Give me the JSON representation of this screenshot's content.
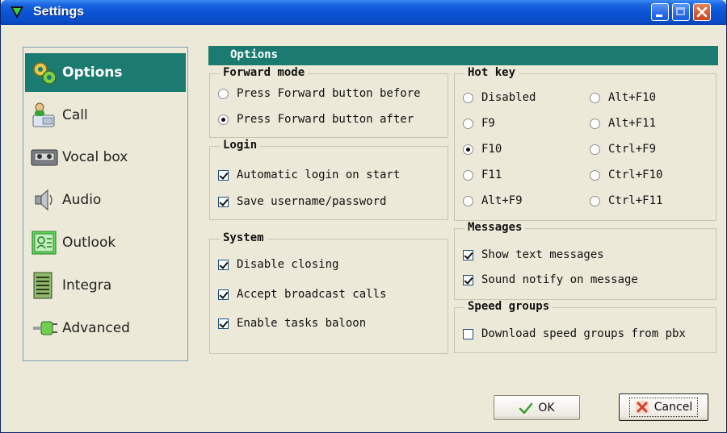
{
  "window": {
    "title": "Settings"
  },
  "sidebar": {
    "items": [
      {
        "label": "Options",
        "icon": "gears-icon",
        "selected": true
      },
      {
        "label": "Call",
        "icon": "phone-icon"
      },
      {
        "label": "Vocal box",
        "icon": "voicemail-tape-icon"
      },
      {
        "label": "Audio",
        "icon": "speaker-icon"
      },
      {
        "label": "Outlook",
        "icon": "outlook-contact-icon"
      },
      {
        "label": "Integra",
        "icon": "integra-rack-icon"
      },
      {
        "label": "Advanced",
        "icon": "plug-icon"
      }
    ]
  },
  "panel": {
    "title": "Options"
  },
  "forward_mode": {
    "title": "Forward mode",
    "options": [
      "Press Forward button before",
      "Press Forward button after"
    ],
    "selected": "Press Forward button after"
  },
  "login": {
    "title": "Login",
    "options": [
      {
        "label": "Automatic login on start",
        "checked": true
      },
      {
        "label": "Save username/password",
        "checked": true
      }
    ]
  },
  "system": {
    "title": "System",
    "options": [
      {
        "label": "Disable closing",
        "checked": true
      },
      {
        "label": "Accept broadcast calls",
        "checked": true
      },
      {
        "label": "Enable tasks baloon",
        "checked": true
      }
    ]
  },
  "hot_key": {
    "title": "Hot key",
    "options": [
      "Disabled",
      "F9",
      "F10",
      "F11",
      "Alt+F9",
      "Alt+F10",
      "Alt+F11",
      "Ctrl+F9",
      "Ctrl+F10",
      "Ctrl+F11"
    ],
    "selected": "F10"
  },
  "messages": {
    "title": "Messages",
    "options": [
      {
        "label": "Show text messages",
        "checked": true
      },
      {
        "label": "Sound notify on message",
        "checked": true
      }
    ]
  },
  "speed_groups": {
    "title": "Speed groups",
    "options": [
      {
        "label": "Download speed groups from pbx",
        "checked": false
      }
    ]
  },
  "buttons": {
    "ok": "OK",
    "cancel": "Cancel"
  },
  "colors": {
    "accent": "#1b7b70",
    "titlebar": "#0a55d6",
    "window_bg": "#ece9d8"
  }
}
